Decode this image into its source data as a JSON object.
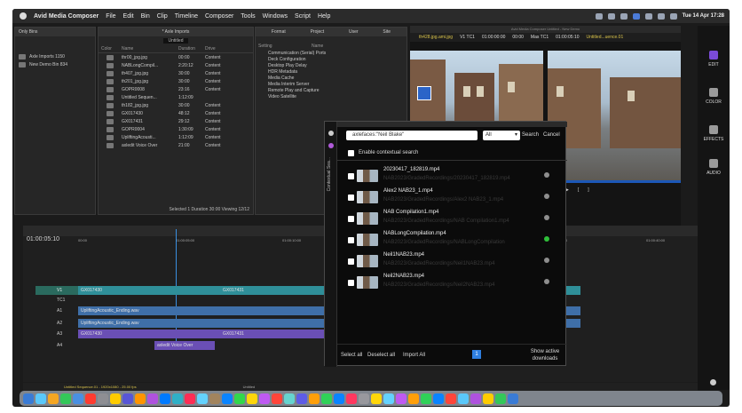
{
  "menubar": {
    "app": "Avid Media Composer",
    "items": [
      "File",
      "Edit",
      "Bin",
      "Clip",
      "Timeline",
      "Composer",
      "Tools",
      "Windows",
      "Script",
      "Help"
    ],
    "clock": "Tue 14 Apr 17:28"
  },
  "bins": {
    "header_left": "Only Bins",
    "items": [
      "Axle Imports 1150",
      "New Demo Bin 834"
    ],
    "title": "* Axle Imports",
    "view": "Untitled",
    "columns": [
      "Color",
      "Name",
      "Duration",
      "Drive"
    ],
    "rows": [
      [
        "thr00_jpg.jpg",
        "00:00",
        "Content"
      ],
      [
        "NABLongCompil...",
        "2:20:12",
        "Content"
      ],
      [
        "th407_jpg.jpg",
        "30:00",
        "Content"
      ],
      [
        "th201_jpg.jpg",
        "30:00",
        "Content"
      ],
      [
        "GOPR0008",
        "23:16",
        "Content"
      ],
      [
        "Untitled Sequen...",
        "1:12:09",
        ""
      ],
      [
        "th182_jpg.jpg",
        "30:00",
        "Content"
      ],
      [
        "GX017430",
        "48:12",
        "Content"
      ],
      [
        "GX017431",
        "29:12",
        "Content"
      ],
      [
        "GOPR0004",
        "1:30:09",
        "Content"
      ],
      [
        "UpliftingAcousti...",
        "1:12:09",
        "Content"
      ],
      [
        "axledit Voice Over",
        "21:00",
        "Content"
      ]
    ],
    "status": "Selected 1 Duration 30:00 Viewing 12/12"
  },
  "settings": {
    "tabs": [
      "Format",
      "Project",
      "User",
      "Site"
    ],
    "header": "Setting",
    "name_col": "Name",
    "items": [
      "Communication (Serial) Ports",
      "Deck Configuration",
      "Desktop Play Delay",
      "HDR Metadata",
      "Media Cache",
      "Media Interim Server",
      "Remote Play and Capture",
      "Video Satellite"
    ]
  },
  "viewer": {
    "window_title": "Avid Media Composer Untitled - New Demo",
    "clip_left": "th428.jpg.ami.jpg",
    "track": "V1 TC1",
    "tc_left": "01:00:00:00",
    "tc_mid": "00:00",
    "mas": "Mas TC1",
    "tc_right": "01:00:05:10",
    "seq": "Untitled...uence.01"
  },
  "sidebar": {
    "items": [
      "EDIT",
      "COLOR",
      "EFFECTS",
      "AUDIO"
    ]
  },
  "timeline": {
    "timecode": "01:00:05:10",
    "ruler": [
      "00:00",
      "01:00:05:00",
      "01:00:10:00",
      "01:00:15:00",
      "01:00:35:00",
      "01:00:40:00"
    ],
    "tracks": [
      "V1",
      "TC1",
      "A1",
      "A2",
      "A3",
      "A4"
    ],
    "clips": {
      "v1a": "GX017430",
      "v1b": "GX017431",
      "a1": "UpliftingAcoustic_Ending.wav",
      "a2": "UpliftingAcoustic_Ending.wav",
      "a3a": "GX017430",
      "a3b": "GX017431",
      "a4": "axledit Voice Over"
    },
    "status": "Untitled Sequence.01 - 1920x1080 - 25.00 fps",
    "status_right": "Untitled"
  },
  "search_modal": {
    "query": "axlefaces:\"Neil Blake\"",
    "scope": "All",
    "search_label": "Search",
    "cancel_label": "Cancel",
    "contextual_label": "Enable contextual search",
    "results": [
      {
        "name": "20230417_182819.mp4",
        "path": "NAB2023/GradedRecordings/20230417_182819.mp4",
        "status": "grey"
      },
      {
        "name": "Alex2 NAB23_1.mp4",
        "path": "NAB2023/GradedRecordings/Alex2 NAB23_1.mp4",
        "status": "grey"
      },
      {
        "name": "NAB Compilation1.mp4",
        "path": "NAB2023/GradedRecordings/NAB Compilation1.mp4",
        "status": "grey"
      },
      {
        "name": "NABLongCompilation.mp4",
        "path": "NAB2023/GradedRecordings/NABLongCompilation",
        "status": "green"
      },
      {
        "name": "Neil1NAB23.mp4",
        "path": "NAB2023/GradedRecordings/Neil1NAB23.mp4",
        "status": "grey"
      },
      {
        "name": "Neil2NAB23.mp4",
        "path": "NAB2023/GradedRecordings/Neil2NAB23.mp4",
        "status": "grey"
      }
    ],
    "select_all": "Select all",
    "deselect_all": "Deselect all",
    "import_all": "Import All",
    "page": "1",
    "show_downloads": "Show active downloads",
    "side_tab": "Contextual Sea..."
  },
  "colors": {
    "accent_blue": "#2f7fe0",
    "clip_teal": "#2f8f99",
    "clip_audio": "#3f6fa8",
    "clip_purple": "#6a4fb5",
    "status_green": "#2fbf3a"
  }
}
